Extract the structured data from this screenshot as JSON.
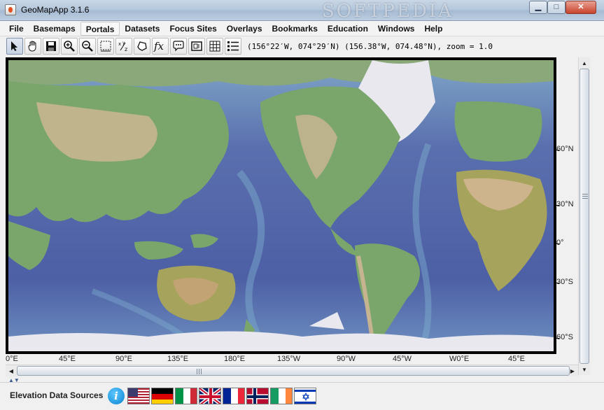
{
  "window": {
    "title": "GeoMapApp 3.1.6",
    "watermark": "SOFTPEDIA",
    "controls": {
      "minimize": "▁",
      "maximize": "□",
      "close": "✕"
    }
  },
  "menu": {
    "items": [
      "File",
      "Basemaps",
      "Portals",
      "Datasets",
      "Focus Sites",
      "Overlays",
      "Bookmarks",
      "Education",
      "Windows",
      "Help"
    ],
    "highlighted": "Portals"
  },
  "toolbar": {
    "tools": [
      "select-arrow-icon",
      "pan-hand-icon",
      "save-disk-icon",
      "zoom-in-icon",
      "zoom-out-icon",
      "rectangle-select-icon",
      "xyz-icon",
      "lasso-icon",
      "function-icon",
      "speech-bubble-icon",
      "frame-icon",
      "grid-icon",
      "list-icon"
    ],
    "coordinate_readout": "(156°22′W, 074°29′N) (156.38°W, 074.48°N), zoom = 1.0"
  },
  "map": {
    "latitude_labels": [
      "60°N",
      "30°N",
      "0°",
      "30°S",
      "60°S"
    ],
    "longitude_labels": [
      "0°E",
      "45°E",
      "90°E",
      "135°E",
      "180°E",
      "135°W",
      "90°W",
      "45°W",
      "W0°E",
      "45°E"
    ],
    "colors": {
      "ocean_deep": "#4d5fa5",
      "ocean_shallow": "#7fb1cf",
      "land_low": "#7aa66b",
      "land_high": "#d8b898",
      "ice": "#e8e8ee"
    }
  },
  "bottom": {
    "elevation_label": "Elevation Data Sources",
    "info_glyph": "i",
    "flags": [
      "United States",
      "Germany",
      "Italy",
      "United Kingdom",
      "France",
      "Norway",
      "Ireland",
      "Israel"
    ]
  }
}
